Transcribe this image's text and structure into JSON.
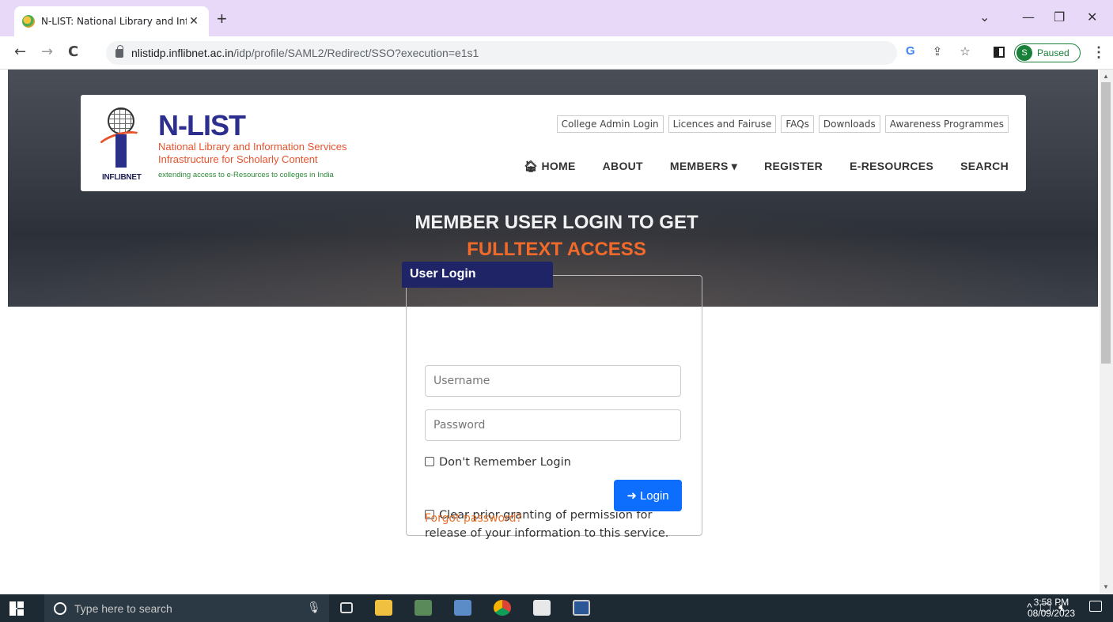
{
  "browser": {
    "tab_title": "N-LIST: National Library and Info",
    "tab_close": "✕",
    "new_tab": "+",
    "url_host": "nlistidp.inflibnet.ac.in",
    "url_path": "/idp/profile/SAML2/Redirect/SSO?execution=e1s1",
    "profile_initial": "S",
    "profile_status": "Paused",
    "window_controls": [
      "⌄",
      "—",
      "❐",
      "✕"
    ]
  },
  "header": {
    "brand_title": "N-LIST",
    "brand_line1": "National Library and Information Services",
    "brand_line2": "Infrastructure for Scholarly Content",
    "brand_tagline": "extending access to e-Resources to colleges in India",
    "logo_text": "INFLIBNET",
    "top_links": [
      "College Admin Login",
      "Licences and Fairuse",
      "FAQs",
      "Downloads",
      "Awareness Programmes"
    ],
    "nav": {
      "home": "HOME",
      "about": "ABOUT",
      "members": "MEMBERS",
      "register": "REGISTER",
      "eresources": "E-RESOURCES",
      "search": "SEARCH"
    }
  },
  "hero": {
    "title": "MEMBER USER LOGIN TO GET",
    "subtitle": "FULLTEXT ACCESS"
  },
  "login": {
    "legend": "User Login",
    "username_placeholder": "Username",
    "password_placeholder": "Password",
    "dont_remember": "Don't Remember Login",
    "clear_prior_line1": "Clear prior granting of permission for",
    "clear_prior_line2": "release of your information to this service.",
    "button": "Login",
    "forgot": "Forgot password?"
  },
  "taskbar": {
    "search_placeholder": "Type here to search",
    "time": "3:58 PM",
    "date": "08/09/2023"
  },
  "colors": {
    "brand_blue": "#2c2f8e",
    "accent_orange": "#f26a2a",
    "login_button": "#0d6efd",
    "legend_bg": "#1f2466"
  }
}
